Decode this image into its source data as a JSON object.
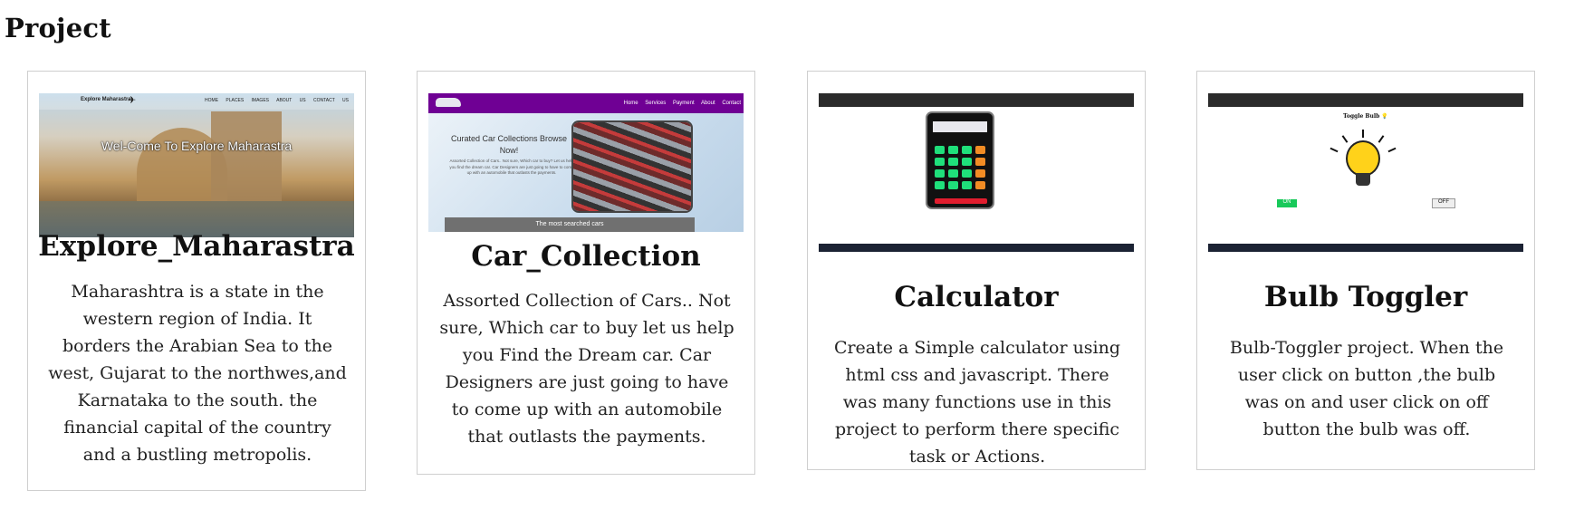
{
  "page": {
    "title": "Project"
  },
  "cards": [
    {
      "title": "Explore_Maharastra",
      "description": "Maharashtra is a state in the western region of India. It borders the Arabian Sea to the west, Gujarat to the northwes,and Karnataka to the south. the financial capital of the country and a bustling metropolis.",
      "thumb": {
        "brand": "Explore Maharastra",
        "nav_links": "HOME PLACES IMAGES ABOUT US CONTACT US",
        "headline": "Wel-Come To Explore Maharastra"
      }
    },
    {
      "title": "Car_Collection",
      "description": "Assorted Collection of Cars.. Not sure, Which car to buy let us help you Find the Dream car. Car Designers are just going to have to come up with an automobile that outlasts the payments.",
      "thumb": {
        "nav_links": "Home Services Payment About Contact",
        "heading": "Curated Car Collections Browse Now!",
        "body": "Assorted Collection of Cars.. Not sure, Which car to buy? Let us help you find the dream car. Car Designers are just going to have to come up with an automobile that outlasts the payments.",
        "bottom_bar": "The most searched cars"
      }
    },
    {
      "title": "Calculator",
      "description": "Create a Simple calculator using html css and javascript. There was many functions use in this project to perform there specific task or Actions."
    },
    {
      "title": "Bulb Toggler",
      "description": "Bulb-Toggler project. When the user click on button ,the bulb was on and user click on off button the bulb was off.",
      "thumb": {
        "heading": "Toggle Bulb 💡",
        "on_label": "ON",
        "off_label": "OFF"
      }
    }
  ]
}
